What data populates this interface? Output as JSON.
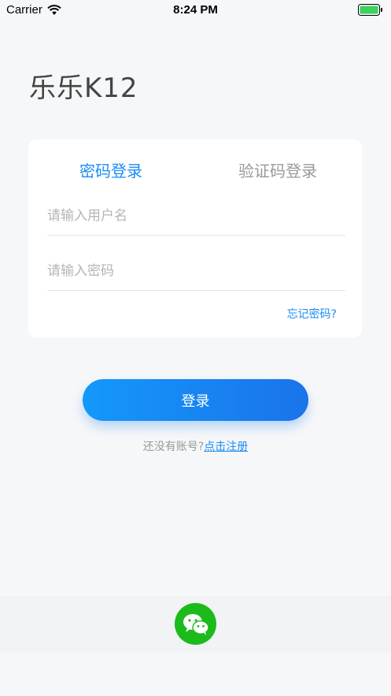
{
  "status_bar": {
    "carrier": "Carrier",
    "time": "8:24 PM",
    "battery_color": "#3dd15f"
  },
  "app": {
    "title": "乐乐K12"
  },
  "login_card": {
    "tabs": [
      {
        "label": "密码登录",
        "active": true
      },
      {
        "label": "验证码登录",
        "active": false
      }
    ],
    "username_placeholder": "请输入用户名",
    "username_value": "",
    "password_placeholder": "请输入密码",
    "password_value": "",
    "forgot_password": "忘记密码?"
  },
  "login_button": {
    "label": "登录"
  },
  "register": {
    "prompt": "还没有账号?",
    "link": "点击注册"
  },
  "social": {
    "icon": "wechat-icon",
    "color": "#1bbb1b"
  },
  "colors": {
    "accent": "#1a8cf5",
    "background": "#f6f7f9"
  }
}
